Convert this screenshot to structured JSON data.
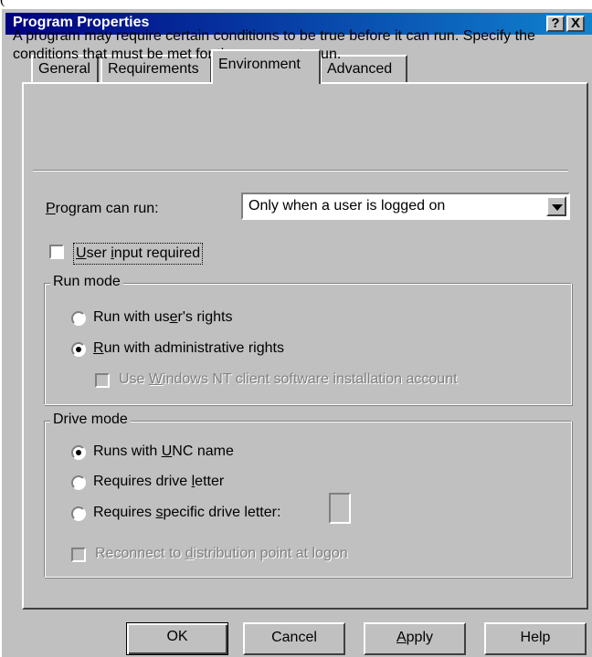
{
  "window": {
    "partial_text_above": "(",
    "title": "Program Properties",
    "help_glyph": "?",
    "close_glyph": "X"
  },
  "tabs": [
    {
      "label": "General",
      "active": false
    },
    {
      "label": "Requirements",
      "active": false
    },
    {
      "label": "Environment",
      "active": true
    },
    {
      "label": "Advanced",
      "active": false
    }
  ],
  "environment": {
    "description": "A program may require certain conditions to be true before it can run. Specify the conditions that must be met for the program to run.",
    "program_can_run_label": "Program can run:",
    "program_can_run_value": "Only when a user is logged on",
    "user_input_required": {
      "label": "User input required",
      "checked": false
    },
    "run_mode": {
      "title": "Run mode",
      "options": [
        {
          "label": "Run with user's rights",
          "checked": false
        },
        {
          "label": "Run with administrative rights",
          "checked": true
        }
      ],
      "nt_client_account": {
        "label": "Use Windows NT client software installation account",
        "checked": false,
        "enabled": false
      }
    },
    "drive_mode": {
      "title": "Drive mode",
      "options": [
        {
          "label": "Runs with UNC name",
          "checked": true
        },
        {
          "label": "Requires drive letter",
          "checked": false
        },
        {
          "label": "Requires specific drive letter:",
          "checked": false
        }
      ],
      "specific_drive_letter_value": "",
      "reconnect": {
        "label": "Reconnect to distribution point at logon",
        "checked": false,
        "enabled": false
      }
    }
  },
  "buttons": {
    "ok": "OK",
    "cancel": "Cancel",
    "apply": "Apply",
    "help": "Help"
  },
  "colors": {
    "face": "#c0c0c0",
    "title_start": "#000080",
    "title_end": "#1084d0",
    "disabled_text": "#808080"
  }
}
